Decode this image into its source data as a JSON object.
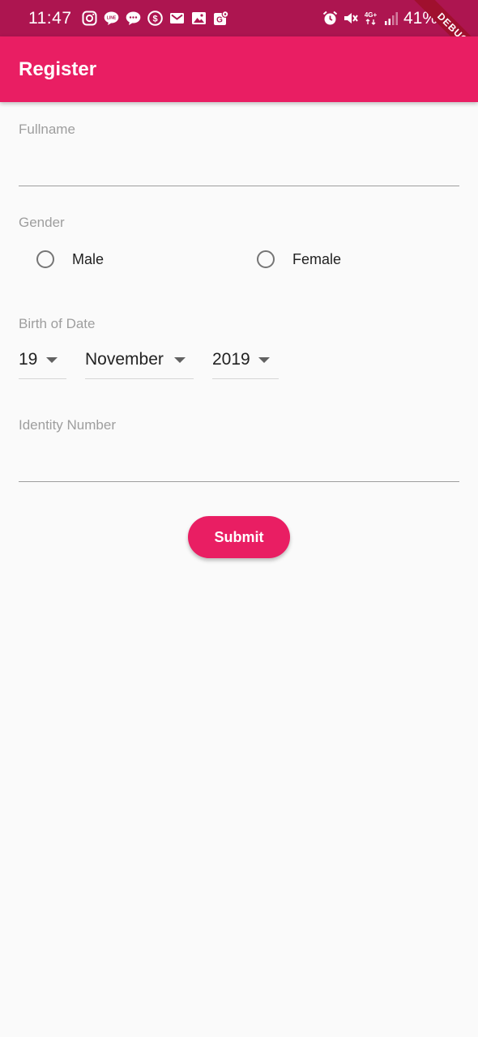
{
  "status_bar": {
    "time": "11:47",
    "battery": "41%",
    "left_icons": [
      "instagram-icon",
      "line-icon",
      "chat-icon",
      "dollar-icon",
      "mail-icon",
      "gallery-icon",
      "maps-icon"
    ],
    "right_icons": [
      "alarm-icon",
      "mute-icon",
      "network-4g-icon",
      "signal-icon"
    ],
    "network_label": "4G+"
  },
  "debug_banner": "DEBUG",
  "app_bar": {
    "title": "Register"
  },
  "form": {
    "fullname_label": "Fullname",
    "fullname_value": "",
    "gender_label": "Gender",
    "gender_options": [
      "Male",
      "Female"
    ],
    "birth_label": "Birth of Date",
    "birth_day": "19",
    "birth_month": "November",
    "birth_year": "2019",
    "identity_label": "Identity Number",
    "identity_value": "",
    "submit_label": "Submit"
  },
  "colors": {
    "primary": "#e91e63",
    "primary_dark": "#ad1550",
    "background": "#fafafa",
    "label_gray": "#9e9e9e"
  }
}
